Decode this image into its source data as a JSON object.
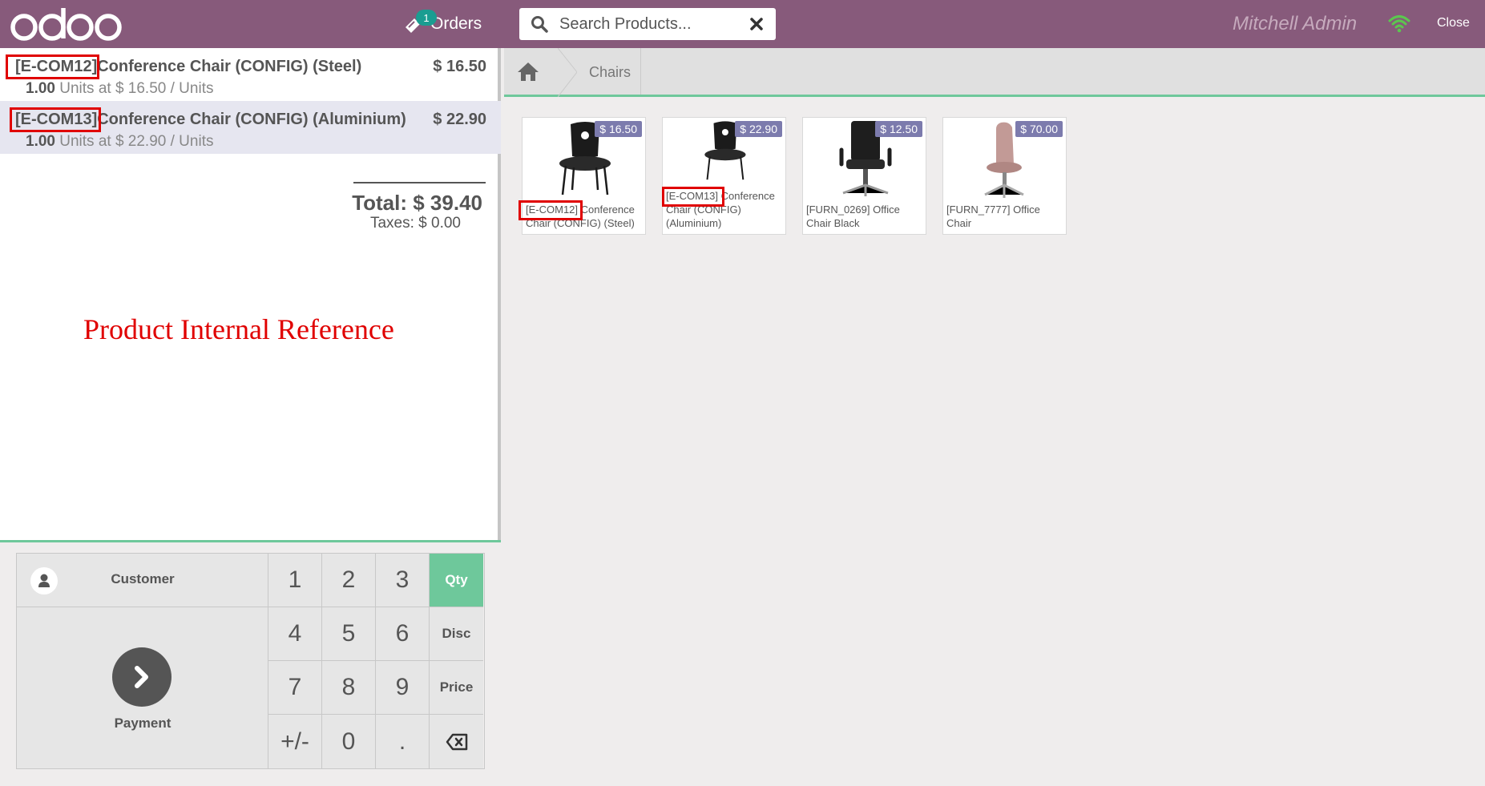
{
  "header": {
    "logo_text": "odoo",
    "orders_label": "Orders",
    "orders_count": "1",
    "search_placeholder": "Search Products...",
    "user_name": "Mitchell Admin",
    "close_label": "Close"
  },
  "order": {
    "lines": [
      {
        "ref": "[E-COM12]",
        "name": "Conference Chair (CONFIG) (Steel)",
        "price": "$ 16.50",
        "qty": "1.00",
        "info": " Units at $ 16.50 / Units"
      },
      {
        "ref": "[E-COM13]",
        "name": "Conference Chair (CONFIG) (Aluminium)",
        "price": "$ 22.90",
        "qty": "1.00",
        "info": " Units at $ 22.90 / Units"
      }
    ],
    "total": "Total: $ 39.40",
    "taxes": "Taxes: $ 0.00"
  },
  "annotation": "Product Internal Reference",
  "actions": {
    "customer_label": "Customer",
    "payment_label": "Payment"
  },
  "numpad": {
    "keys": [
      "1",
      "2",
      "3",
      "Qty",
      "4",
      "5",
      "6",
      "Disc",
      "7",
      "8",
      "9",
      "Price",
      "+/-",
      "0",
      ".",
      "⌫"
    ],
    "active_mode": "Qty"
  },
  "breadcrumb": {
    "category": "Chairs"
  },
  "products": [
    {
      "price": "$ 16.50",
      "name": "[E-COM12] Conference Chair (CONFIG) (Steel)"
    },
    {
      "price": "$ 22.90",
      "name": "[E-COM13] Conference Chair (CONFIG) (Aluminium)"
    },
    {
      "price": "$ 12.50",
      "name": "[FURN_0269] Office Chair Black"
    },
    {
      "price": "$ 70.00",
      "name": "[FURN_7777] Office Chair"
    }
  ],
  "colors": {
    "header": "#875a7b",
    "accent_green": "#6ec89b",
    "price_tag": "#7c7bad",
    "highlight_red": "#e00000"
  }
}
